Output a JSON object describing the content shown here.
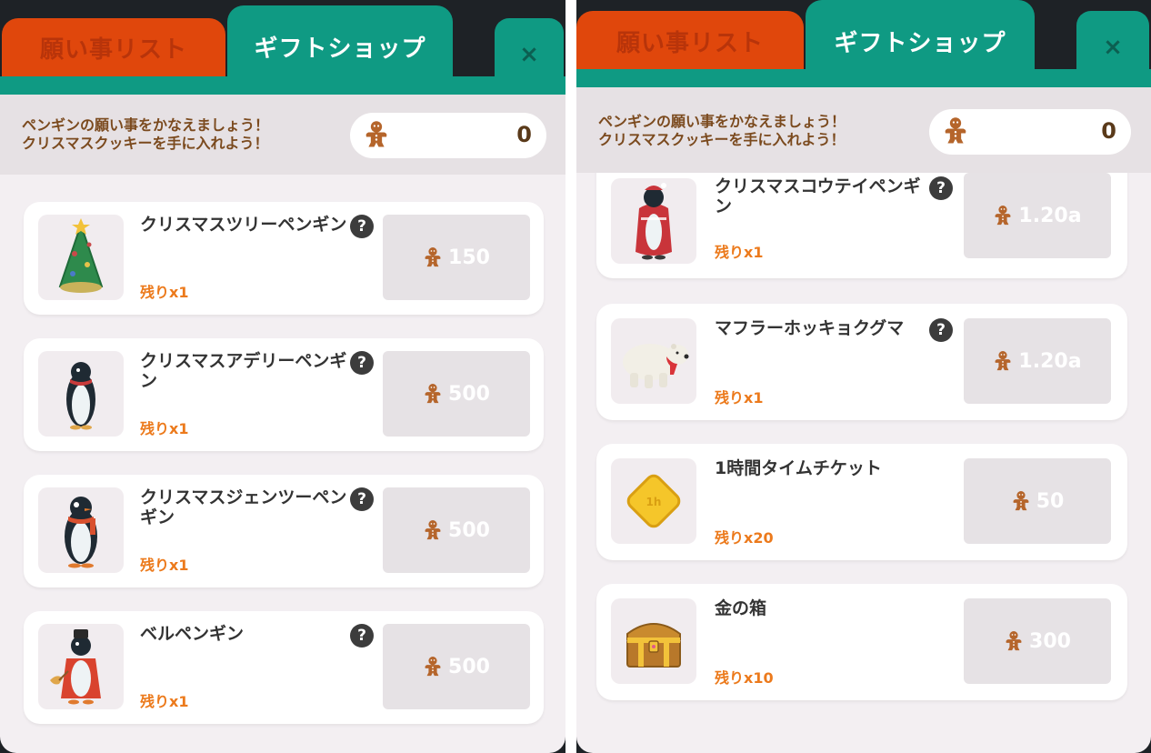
{
  "tabs": {
    "wish_list": "願い事リスト",
    "gift_shop": "ギフトショップ",
    "close": "×"
  },
  "header": {
    "message_line1": "ペンギンの願い事をかなえましょう！",
    "message_line2": "クリスマスクッキーを手に入れよう！",
    "cookie_count": "0"
  },
  "left_items": [
    {
      "name": "クリスマスツリーペンギン",
      "remaining": "残りx1",
      "price": "150",
      "help": "?",
      "icon": "christmas-tree-penguin-icon"
    },
    {
      "name": "クリスマスアデリーペンギン",
      "remaining": "残りx1",
      "price": "500",
      "help": "?",
      "icon": "adelie-penguin-icon"
    },
    {
      "name": "クリスマスジェンツーペンギン",
      "remaining": "残りx1",
      "price": "500",
      "help": "?",
      "icon": "gentoo-penguin-icon"
    },
    {
      "name": "ベルペンギン",
      "remaining": "残りx1",
      "price": "500",
      "help": "?",
      "icon": "bell-penguin-icon"
    }
  ],
  "right_items": [
    {
      "name": "クリスマスコウテイペンギン",
      "remaining": "残りx1",
      "price": "1.20a",
      "help": "?",
      "icon": "emperor-penguin-icon"
    },
    {
      "name": "マフラーホッキョクグマ",
      "remaining": "残りx1",
      "price": "1.20a",
      "help": "?",
      "icon": "polar-bear-icon"
    },
    {
      "name": "1時間タイムチケット",
      "remaining": "残りx20",
      "price": "50",
      "icon": "time-ticket-icon"
    },
    {
      "name": "金の箱",
      "remaining": "残りx10",
      "price": "300",
      "icon": "gold-chest-icon"
    }
  ],
  "colors": {
    "teal": "#0f9a83",
    "orange_tab": "#e0470c",
    "remaining_text": "#ec7a1c",
    "cookie": "#b5652b"
  }
}
